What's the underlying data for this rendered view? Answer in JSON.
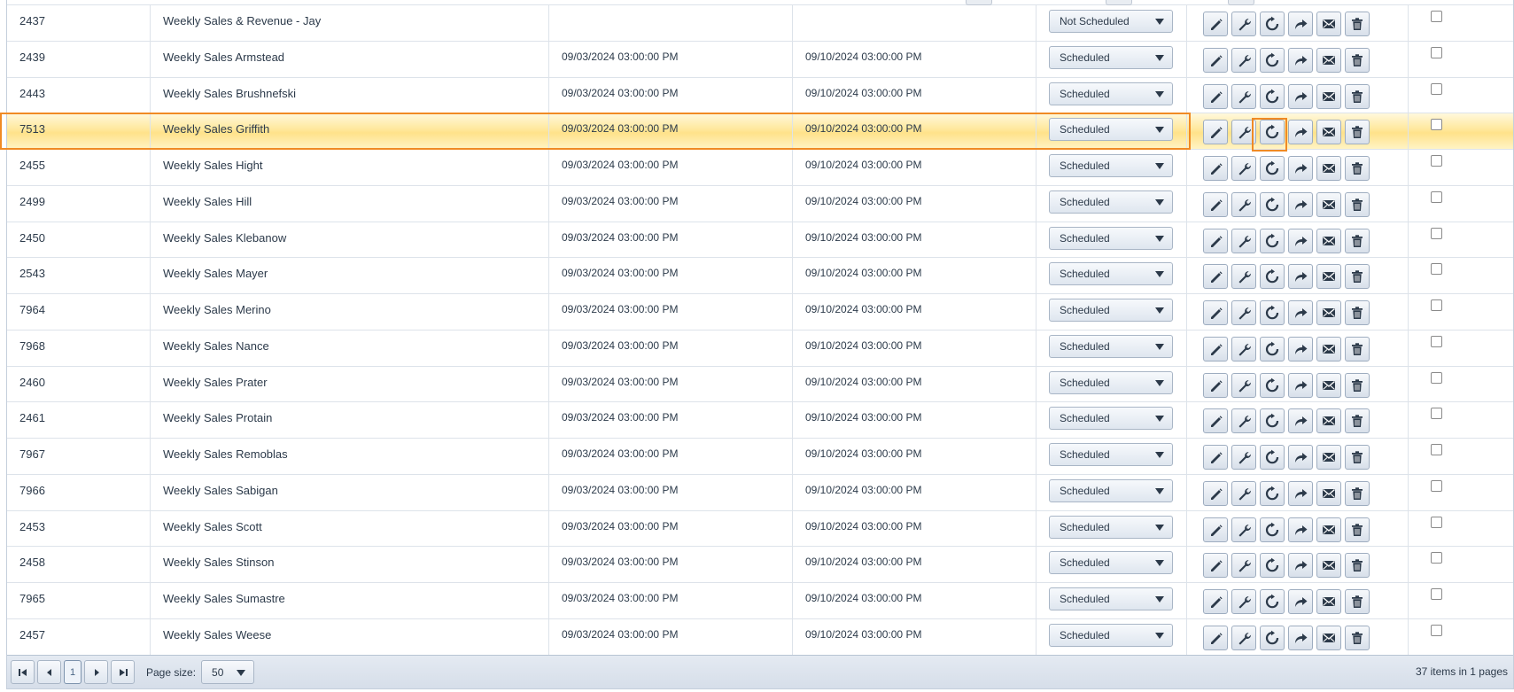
{
  "grid": {
    "rows": [
      {
        "id": "2437",
        "name": "Weekly Sales & Revenue - Jay",
        "start": "",
        "end": "",
        "status": "Not Scheduled"
      },
      {
        "id": "2439",
        "name": "Weekly Sales Armstead",
        "start": "09/03/2024 03:00:00 PM",
        "end": "09/10/2024 03:00:00 PM",
        "status": "Scheduled"
      },
      {
        "id": "2443",
        "name": "Weekly Sales Brushnefski",
        "start": "09/03/2024 03:00:00 PM",
        "end": "09/10/2024 03:00:00 PM",
        "status": "Scheduled"
      },
      {
        "id": "7513",
        "name": "Weekly Sales Griffith",
        "start": "09/03/2024 03:00:00 PM",
        "end": "09/10/2024 03:00:00 PM",
        "status": "Scheduled",
        "highlight": true
      },
      {
        "id": "2455",
        "name": "Weekly Sales Hight",
        "start": "09/03/2024 03:00:00 PM",
        "end": "09/10/2024 03:00:00 PM",
        "status": "Scheduled"
      },
      {
        "id": "2499",
        "name": "Weekly Sales Hill",
        "start": "09/03/2024 03:00:00 PM",
        "end": "09/10/2024 03:00:00 PM",
        "status": "Scheduled"
      },
      {
        "id": "2450",
        "name": "Weekly Sales Klebanow",
        "start": "09/03/2024 03:00:00 PM",
        "end": "09/10/2024 03:00:00 PM",
        "status": "Scheduled"
      },
      {
        "id": "2543",
        "name": "Weekly Sales Mayer",
        "start": "09/03/2024 03:00:00 PM",
        "end": "09/10/2024 03:00:00 PM",
        "status": "Scheduled"
      },
      {
        "id": "7964",
        "name": "Weekly Sales Merino",
        "start": "09/03/2024 03:00:00 PM",
        "end": "09/10/2024 03:00:00 PM",
        "status": "Scheduled"
      },
      {
        "id": "7968",
        "name": "Weekly Sales Nance",
        "start": "09/03/2024 03:00:00 PM",
        "end": "09/10/2024 03:00:00 PM",
        "status": "Scheduled"
      },
      {
        "id": "2460",
        "name": "Weekly Sales Prater",
        "start": "09/03/2024 03:00:00 PM",
        "end": "09/10/2024 03:00:00 PM",
        "status": "Scheduled"
      },
      {
        "id": "2461",
        "name": "Weekly Sales Protain",
        "start": "09/03/2024 03:00:00 PM",
        "end": "09/10/2024 03:00:00 PM",
        "status": "Scheduled"
      },
      {
        "id": "7967",
        "name": "Weekly Sales Remoblas",
        "start": "09/03/2024 03:00:00 PM",
        "end": "09/10/2024 03:00:00 PM",
        "status": "Scheduled"
      },
      {
        "id": "7966",
        "name": "Weekly Sales Sabigan",
        "start": "09/03/2024 03:00:00 PM",
        "end": "09/10/2024 03:00:00 PM",
        "status": "Scheduled"
      },
      {
        "id": "2453",
        "name": "Weekly Sales Scott",
        "start": "09/03/2024 03:00:00 PM",
        "end": "09/10/2024 03:00:00 PM",
        "status": "Scheduled"
      },
      {
        "id": "2458",
        "name": "Weekly Sales Stinson",
        "start": "09/03/2024 03:00:00 PM",
        "end": "09/10/2024 03:00:00 PM",
        "status": "Scheduled"
      },
      {
        "id": "7965",
        "name": "Weekly Sales Sumastre",
        "start": "09/03/2024 03:00:00 PM",
        "end": "09/10/2024 03:00:00 PM",
        "status": "Scheduled"
      },
      {
        "id": "2457",
        "name": "Weekly Sales Weese",
        "start": "09/03/2024 03:00:00 PM",
        "end": "09/10/2024 03:00:00 PM",
        "status": "Scheduled"
      }
    ],
    "action_icons": [
      "pencil-icon",
      "wrench-icon",
      "refresh-icon",
      "share-arrow-icon",
      "envelope-icon",
      "trash-icon"
    ]
  },
  "pager": {
    "current_page": "1",
    "page_size_label": "Page size:",
    "page_size_value": "50",
    "info": "37 items in 1 pages"
  },
  "colors": {
    "highlight_outline": "#f08a24",
    "row_highlight": "#ffe89c",
    "border": "#dde3ea"
  }
}
